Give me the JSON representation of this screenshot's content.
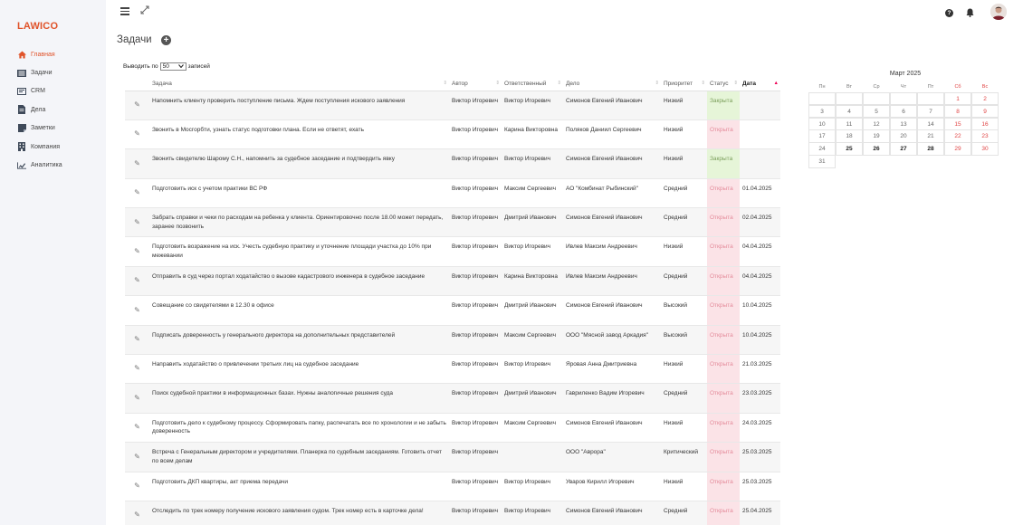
{
  "app": {
    "logo": "LAWICO"
  },
  "sidebar": {
    "items": [
      {
        "label": "Главная",
        "icon": "home-icon",
        "active": true
      },
      {
        "label": "Задачи",
        "icon": "tasks-icon"
      },
      {
        "label": "CRM",
        "icon": "crm-icon"
      },
      {
        "label": "Дела",
        "icon": "case-icon"
      },
      {
        "label": "Заметки",
        "icon": "notes-icon"
      },
      {
        "label": "Компания",
        "icon": "building-icon"
      },
      {
        "label": "Аналитика",
        "icon": "chart-icon"
      }
    ]
  },
  "header": {
    "title": "Задачи"
  },
  "entries": {
    "prefix": "Выводить по",
    "value": "50",
    "suffix": "записей"
  },
  "table": {
    "columns": [
      "Задача",
      "Автор",
      "Ответственный",
      "Дело",
      "Приоритет",
      "Статус",
      "Дата"
    ],
    "rows": [
      {
        "task": "Напомнить клиенту проверить поступление письма. Ждем поступления искового заявления",
        "author": "Виктор Игоревич",
        "responsible": "Виктор Игоревич",
        "case": "Симонов Евгений Иванович",
        "priority": "Низкий",
        "status": "Закрыта",
        "date": ""
      },
      {
        "task": "Звонить в Мосгорбти, узнать статус подготовки плана. Если не ответят, ехать",
        "author": "Виктор Игоревич",
        "responsible": "Карина Викторовна",
        "case": "Поляков Даниил Сергеевич",
        "priority": "Низкий",
        "status": "Открыта",
        "date": ""
      },
      {
        "task": "Звонить свидетелю Шарому С.Н., напомнить за судебное заседание и подтвердить явку",
        "author": "Виктор Игоревич",
        "responsible": "Виктор Игоревич",
        "case": "Симонов Евгений Иванович",
        "priority": "Низкий",
        "status": "Закрыта",
        "date": ""
      },
      {
        "task": "Подготовить иск с учетом практики ВС РФ",
        "author": "Виктор Игоревич",
        "responsible": "Максим Сергеевич",
        "case": "АО \"Комбинат Рыбинский\"",
        "priority": "Средний",
        "status": "Открыта",
        "date": "01.04.2025"
      },
      {
        "task": "Забрать справки и чеки по расходам на ребенка у клиента. Ориентировочно после 18.00 может передать, заранее позвонить",
        "author": "Виктор Игоревич",
        "responsible": "Дмитрий Иванович",
        "case": "Симонов Евгений Иванович",
        "priority": "Средний",
        "status": "Открыта",
        "date": "02.04.2025"
      },
      {
        "task": "Подготовить возражение на иск. Учесть судебную практику и уточнение площади участка до 10% при межевании",
        "author": "Виктор Игоревич",
        "responsible": "Виктор Игоревич",
        "case": "Ивлев Максим Андреевич",
        "priority": "Низкий",
        "status": "Открыта",
        "date": "04.04.2025"
      },
      {
        "task": "Отправить в суд через портал ходатайство о вызове кадастрового инженера в судебное заседание",
        "author": "Виктор Игоревич",
        "responsible": "Карина Викторовна",
        "case": "Ивлев Максим Андреевич",
        "priority": "Средний",
        "status": "Открыта",
        "date": "04.04.2025"
      },
      {
        "task": "Совещание со свидетелями в 12.30 в офисе",
        "author": "Виктор Игоревич",
        "responsible": "Дмитрий Иванович",
        "case": "Симонов Евгений Иванович",
        "priority": "Высокий",
        "status": "Открыта",
        "date": "10.04.2025"
      },
      {
        "task": "Подписать доверенность у генерального директора на дополнительных представителей",
        "author": "Виктор Игоревич",
        "responsible": "Максим Сергеевич",
        "case": "ООО \"Мясной завод Аркадия\"",
        "priority": "Высокий",
        "status": "Открыта",
        "date": "10.04.2025"
      },
      {
        "task": "Направить ходатайство о привлечении третьих лиц на судебное заседание",
        "author": "Виктор Игоревич",
        "responsible": "Виктор Игоревич",
        "case": "Яровая Анна Дмитриевна",
        "priority": "Низкий",
        "status": "Открыта",
        "date": "21.03.2025"
      },
      {
        "task": "Поиск судебной практики в информационных базах. Нужны аналогичные решения суда",
        "author": "Виктор Игоревич",
        "responsible": "Дмитрий Иванович",
        "case": "Гавриленко Вадим Игоревич",
        "priority": "Средний",
        "status": "Открыта",
        "date": "23.03.2025"
      },
      {
        "task": "Подготовить дело к судебному процессу. Сформировать папку, распечатать все по хронологии и не забыть доверенность",
        "author": "Виктор Игоревич",
        "responsible": "Максим Сергеевич",
        "case": "Симонов Евгений Иванович",
        "priority": "Низкий",
        "status": "Открыта",
        "date": "24.03.2025"
      },
      {
        "task": "Встреча с Генеральным директором и учредителями. Планерка по судебным заседаниям. Готовить отчет по всем делам",
        "author": "Виктор Игоревич",
        "responsible": "",
        "case": "ООО \"Аврора\"",
        "priority": "Критический",
        "status": "Открыта",
        "date": "25.03.2025"
      },
      {
        "task": "Подготовить ДКП квартиры, акт приема передачи",
        "author": "Виктор Игоревич",
        "responsible": "Виктор Игоревич",
        "case": "Уваров Кирилл Игоревич",
        "priority": "Низкий",
        "status": "Открыта",
        "date": "25.03.2025"
      },
      {
        "task": "Отследить по трек номеру получение искового заявления судом. Трек номер есть в карточке дела!",
        "author": "Виктор Игоревич",
        "responsible": "Виктор Игоревич",
        "case": "Симонов Евгений Иванович",
        "priority": "Средний",
        "status": "Открыта",
        "date": "25.04.2025"
      }
    ]
  },
  "calendar": {
    "title": "Март 2025",
    "weekdays": [
      "Пн",
      "Вт",
      "Ср",
      "Чт",
      "Пт",
      "Сб",
      "Вс"
    ],
    "weeks": [
      [
        "",
        "",
        "",
        "",
        "",
        "1",
        "2"
      ],
      [
        "3",
        "4",
        "5",
        "6",
        "7",
        "8",
        "9"
      ],
      [
        "10",
        "11",
        "12",
        "13",
        "14",
        "15",
        "16"
      ],
      [
        "17",
        "18",
        "19",
        "20",
        "21",
        "22",
        "23"
      ],
      [
        "24",
        "25",
        "26",
        "27",
        "28",
        "29",
        "30"
      ],
      [
        "31"
      ]
    ],
    "bold_days": [
      "25",
      "26",
      "27",
      "28"
    ],
    "weekend_red_days": [
      "29",
      "30"
    ]
  },
  "colors": {
    "accent": "#e0532a",
    "closed_bg": "#e6f5d8",
    "open_bg": "#fbe3e7"
  }
}
